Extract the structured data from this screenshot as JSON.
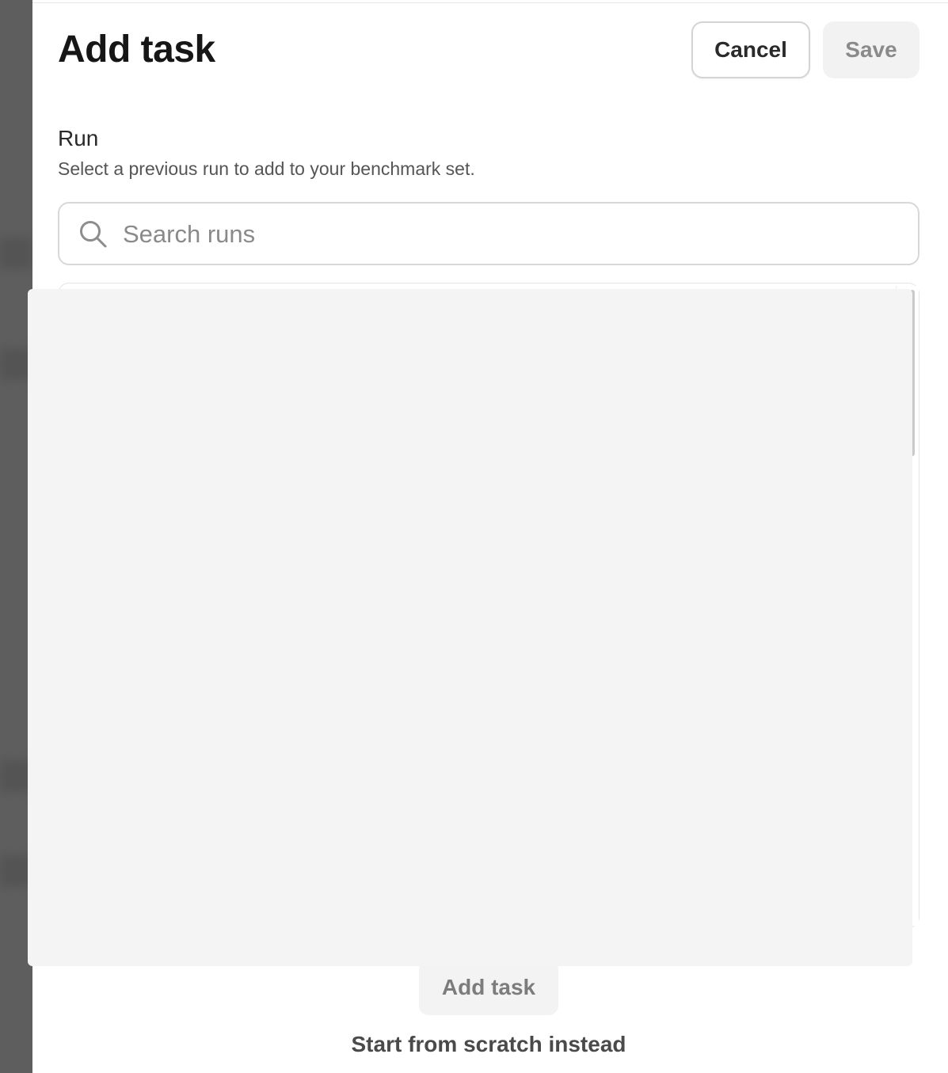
{
  "dialog": {
    "title": "Add task",
    "cancel_label": "Cancel",
    "save_label": "Save"
  },
  "run_field": {
    "label": "Run",
    "help_text": "Select a previous run to add to your benchmark set.",
    "search": {
      "placeholder": "Search runs",
      "value": "",
      "icon": "search-icon"
    }
  },
  "footer": {
    "add_task_label": "Add task",
    "scratch_link_label": "Start from scratch instead"
  },
  "colors": {
    "overlay_background": "#f4f4f4",
    "disabled_button_background": "#f2f2f2",
    "disabled_button_text": "#8a8a8a"
  }
}
